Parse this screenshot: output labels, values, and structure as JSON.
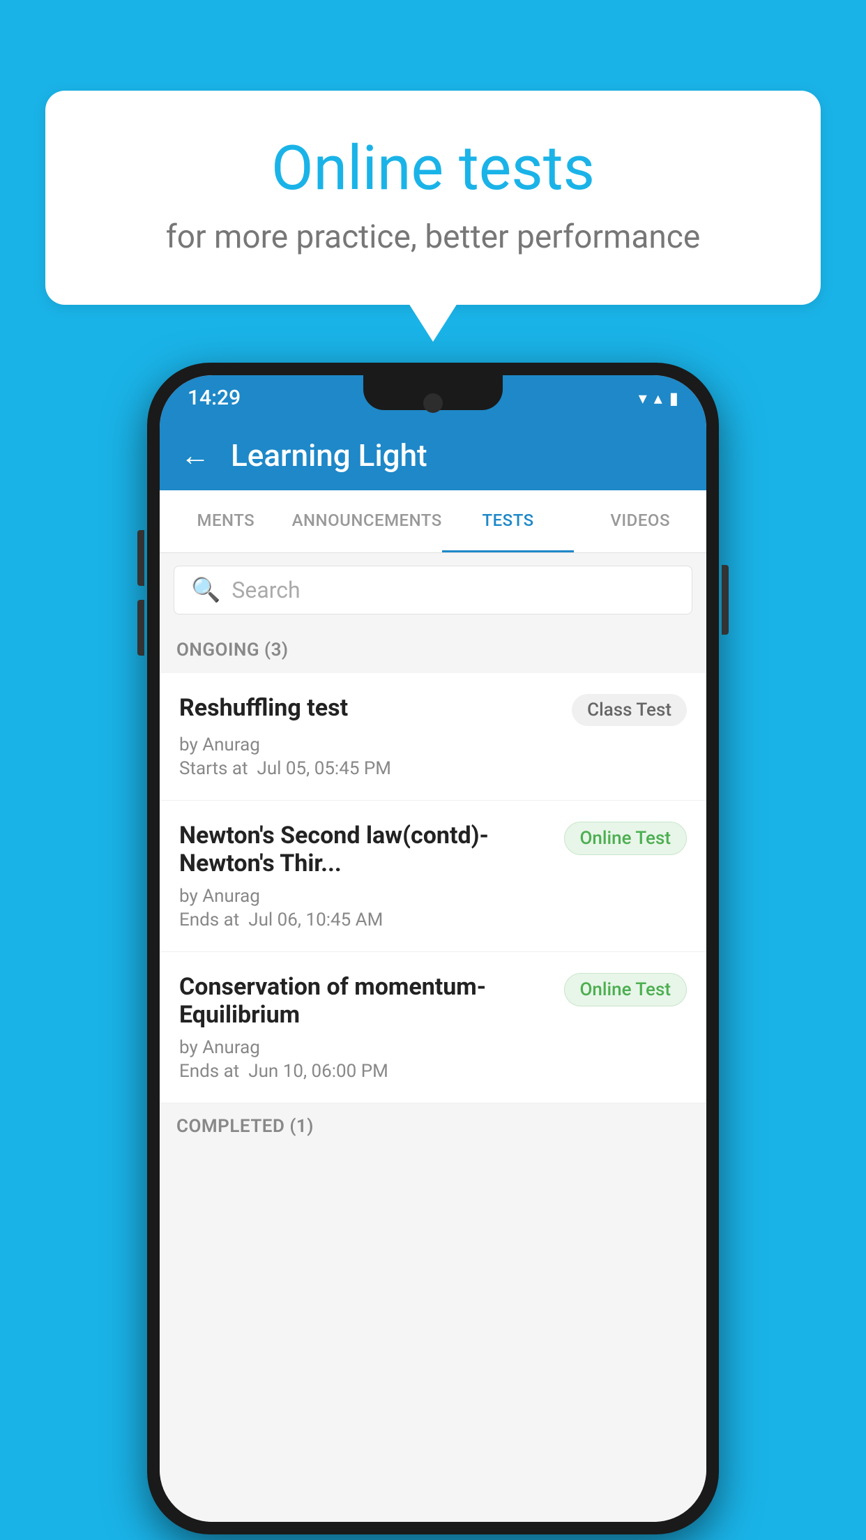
{
  "background": {
    "color": "#1ab3e8"
  },
  "speech_bubble": {
    "title": "Online tests",
    "subtitle": "for more practice, better performance"
  },
  "phone": {
    "status_bar": {
      "time": "14:29",
      "wifi_icon": "▼",
      "signal_icon": "▲",
      "battery_icon": "▮"
    },
    "header": {
      "back_label": "←",
      "title": "Learning Light"
    },
    "tabs": [
      {
        "label": "MENTS",
        "active": false
      },
      {
        "label": "ANNOUNCEMENTS",
        "active": false
      },
      {
        "label": "TESTS",
        "active": true
      },
      {
        "label": "VIDEOS",
        "active": false
      }
    ],
    "search": {
      "placeholder": "Search"
    },
    "ongoing_section": {
      "label": "ONGOING (3)"
    },
    "tests": [
      {
        "name": "Reshuffling test",
        "badge": "Class Test",
        "badge_type": "class",
        "by": "by Anurag",
        "time_label": "Starts at",
        "time_value": "Jul 05, 05:45 PM"
      },
      {
        "name": "Newton's Second law(contd)-Newton's Thir...",
        "badge": "Online Test",
        "badge_type": "online",
        "by": "by Anurag",
        "time_label": "Ends at",
        "time_value": "Jul 06, 10:45 AM"
      },
      {
        "name": "Conservation of momentum-Equilibrium",
        "badge": "Online Test",
        "badge_type": "online",
        "by": "by Anurag",
        "time_label": "Ends at",
        "time_value": "Jun 10, 06:00 PM"
      }
    ],
    "completed_section": {
      "label": "COMPLETED (1)"
    }
  }
}
